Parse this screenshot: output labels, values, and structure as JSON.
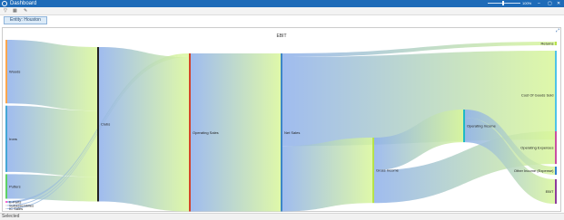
{
  "window": {
    "title": "Dashboard",
    "zoom_label": "100%",
    "minimize": "–",
    "restore": "▢",
    "close": "✕"
  },
  "toolbar": {
    "filter_icon": "▽",
    "grid_icon": "▦",
    "edit_icon": "✎"
  },
  "tab": {
    "label": "Entity: Houston"
  },
  "panel": {
    "expand_icon": "⤢"
  },
  "status": {
    "text": "Selected"
  },
  "chart_data": {
    "type": "sankey",
    "title": "EBIT",
    "nodes": [
      {
        "id": "Woods",
        "label": "Woods",
        "color": "#ffa64d"
      },
      {
        "id": "Irons",
        "label": "Irons",
        "color": "#45a6d6"
      },
      {
        "id": "Putters",
        "label": "Putters",
        "color": "#5fd066"
      },
      {
        "id": "E-Parts",
        "label": "E-Parts",
        "color": "#ff66cc"
      },
      {
        "id": "Subassemblies",
        "label": "Subassemblies",
        "color": "#d9d9d9"
      },
      {
        "id": "IC Sales",
        "label": "IC Sales",
        "color": "#d9d9d9"
      },
      {
        "id": "Clubs",
        "label": "Clubs",
        "color": "#222222"
      },
      {
        "id": "Operating Sales",
        "label": "Operating Sales",
        "color": "#d2452c"
      },
      {
        "id": "Net Sales",
        "label": "Net Sales",
        "color": "#3d86c6"
      },
      {
        "id": "Gross Income",
        "label": "Gross Income",
        "color": "#b7e24a"
      },
      {
        "id": "Operating Income",
        "label": "Operating Income",
        "color": "#1fb9c6"
      },
      {
        "id": "Returns",
        "label": "Returns",
        "color": "#b7e24a"
      },
      {
        "id": "Cost Of Goods Sold",
        "label": "Cost Of Goods Sold",
        "color": "#4fc3e8"
      },
      {
        "id": "Operating Expenses",
        "label": "Operating Expenses",
        "color": "#c94fa3"
      },
      {
        "id": "Other Income (Expense)",
        "label": "Other Income (Expense)",
        "color": "#2e7fd0"
      },
      {
        "id": "EBIT",
        "label": "EBIT",
        "color": "#8e3c9c"
      }
    ],
    "links": [
      {
        "source": "Woods",
        "target": "Clubs",
        "value": 70
      },
      {
        "source": "Irons",
        "target": "Clubs",
        "value": 73
      },
      {
        "source": "Putters",
        "target": "Clubs",
        "value": 27
      },
      {
        "source": "E-Parts",
        "target": "Operating Sales",
        "value": 2
      },
      {
        "source": "Subassemblies",
        "target": "Operating Sales",
        "value": 1
      },
      {
        "source": "IC Sales",
        "target": "Operating Sales",
        "value": 1
      },
      {
        "source": "Clubs",
        "target": "Operating Sales",
        "value": 170
      },
      {
        "source": "Operating Sales",
        "target": "Net Sales",
        "value": 174
      },
      {
        "source": "Net Sales",
        "target": "Returns",
        "value": 4
      },
      {
        "source": "Net Sales",
        "target": "Cost Of Goods Sold",
        "value": 98
      },
      {
        "source": "Net Sales",
        "target": "Gross Income",
        "value": 72
      },
      {
        "source": "Gross Income",
        "target": "Operating Income",
        "value": 36
      },
      {
        "source": "Gross Income",
        "target": "Operating Expenses",
        "value": 36
      },
      {
        "source": "Operating Income",
        "target": "Other Income (Expense)",
        "value": 9
      },
      {
        "source": "Operating Income",
        "target": "EBIT",
        "value": 27
      }
    ]
  }
}
